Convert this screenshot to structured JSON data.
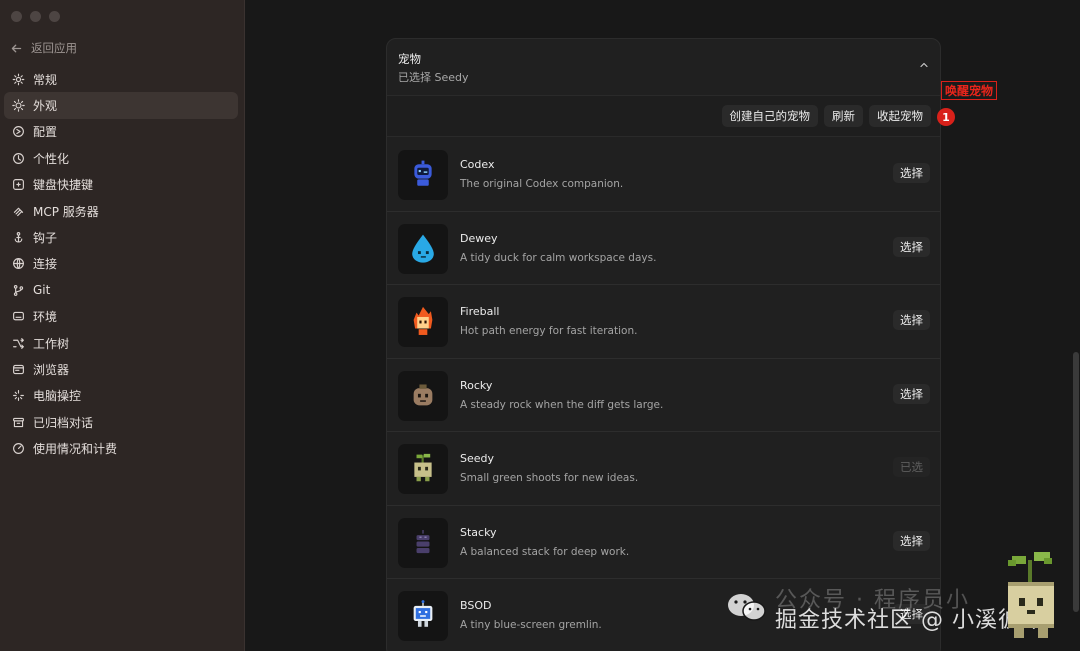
{
  "sidebar": {
    "back_label": "返回应用",
    "items": [
      {
        "label": "常规",
        "icon": "gear-icon"
      },
      {
        "label": "外观",
        "icon": "sun-icon"
      },
      {
        "label": "配置",
        "icon": "config-icon"
      },
      {
        "label": "个性化",
        "icon": "personalize-icon"
      },
      {
        "label": "键盘快捷键",
        "icon": "keyboard-icon"
      },
      {
        "label": "MCP 服务器",
        "icon": "mcp-icon"
      },
      {
        "label": "钩子",
        "icon": "hook-icon"
      },
      {
        "label": "连接",
        "icon": "globe-icon"
      },
      {
        "label": "Git",
        "icon": "git-branch-icon"
      },
      {
        "label": "环境",
        "icon": "monitor-icon"
      },
      {
        "label": "工作树",
        "icon": "worktree-icon"
      },
      {
        "label": "浏览器",
        "icon": "browser-icon"
      },
      {
        "label": "电脑操控",
        "icon": "sparkle-icon"
      },
      {
        "label": "已归档对话",
        "icon": "archive-icon"
      },
      {
        "label": "使用情况和计费",
        "icon": "gauge-icon"
      }
    ],
    "active_index": 1
  },
  "section": {
    "title": "宠物",
    "subtitle": "已选择 Seedy"
  },
  "toolbar": {
    "create_label": "创建自己的宠物",
    "refresh_label": "刷新",
    "collapse_label": "收起宠物"
  },
  "pets": [
    {
      "name": "Codex",
      "description": "The original Codex companion.",
      "action": "选择",
      "selected": false,
      "color": "#3b5bdb"
    },
    {
      "name": "Dewey",
      "description": "A tidy duck for calm workspace days.",
      "action": "选择",
      "selected": false,
      "color": "#29a9e6"
    },
    {
      "name": "Fireball",
      "description": "Hot path energy for fast iteration.",
      "action": "选择",
      "selected": false,
      "color": "#f05a1e"
    },
    {
      "name": "Rocky",
      "description": "A steady rock when the diff gets large.",
      "action": "选择",
      "selected": false,
      "color": "#9a7c62"
    },
    {
      "name": "Seedy",
      "description": "Small green shoots for new ideas.",
      "action": "已选",
      "selected": true,
      "color": "#c7c08a"
    },
    {
      "name": "Stacky",
      "description": "A balanced stack for deep work.",
      "action": "选择",
      "selected": false,
      "color": "#4a3f6b"
    },
    {
      "name": "BSOD",
      "description": "A tiny blue-screen gremlin.",
      "action": "选择",
      "selected": false,
      "color": "#2f6fe0"
    }
  ],
  "annotation": {
    "label": "唤醒宠物",
    "number": "1"
  },
  "watermark": {
    "line1": "公众号 · 程序员小",
    "line2": "掘金技术社区 @ 小溪彼岸"
  }
}
